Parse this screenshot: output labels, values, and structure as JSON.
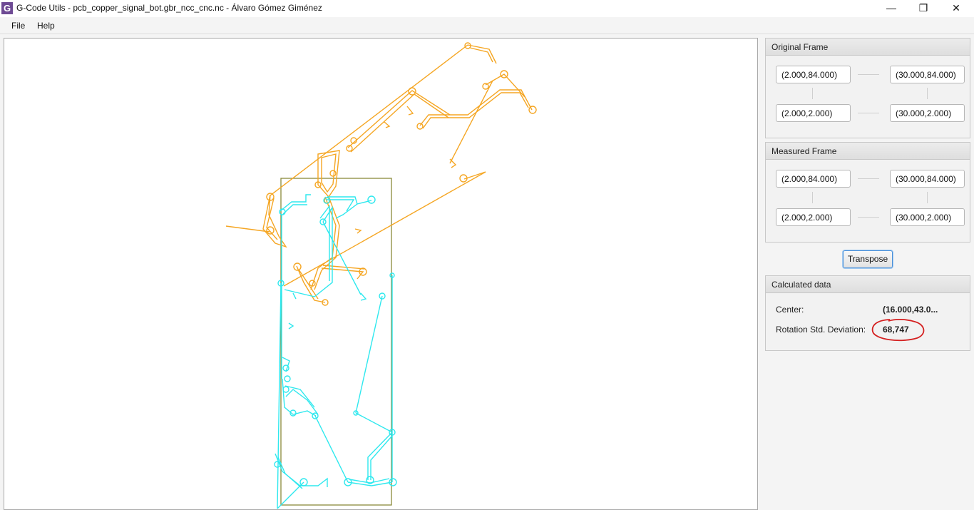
{
  "window": {
    "icon_letter": "G",
    "title": "G-Code Utils - pcb_copper_signal_bot.gbr_ncc_cnc.nc - Álvaro Gómez Giménez",
    "minimize": "—",
    "restore": "❐",
    "close": "✕"
  },
  "menu": {
    "items": [
      "File",
      "Help"
    ]
  },
  "original_frame": {
    "title": "Original Frame",
    "top_left": "(2.000,84.000)",
    "top_right": "(30.000,84.000)",
    "bottom_left": "(2.000,2.000)",
    "bottom_right": "(30.000,2.000)"
  },
  "measured_frame": {
    "title": "Measured Frame",
    "top_left": "(2.000,84.000)",
    "top_right": "(30.000,84.000)",
    "bottom_left": "(2.000,2.000)",
    "bottom_right": "(30.000,2.000)"
  },
  "transpose_label": "Transpose",
  "calculated": {
    "title": "Calculated data",
    "center_label": "Center:",
    "center_value": "(16.000,43.0...",
    "rotation_label": "Rotation Std. Deviation:",
    "rotation_value": "68,747"
  },
  "colors": {
    "original_path": "#f5a623",
    "transformed_path": "#2ee8ee",
    "frame_rect": "#8a8a3a",
    "annotation": "#d42020"
  }
}
